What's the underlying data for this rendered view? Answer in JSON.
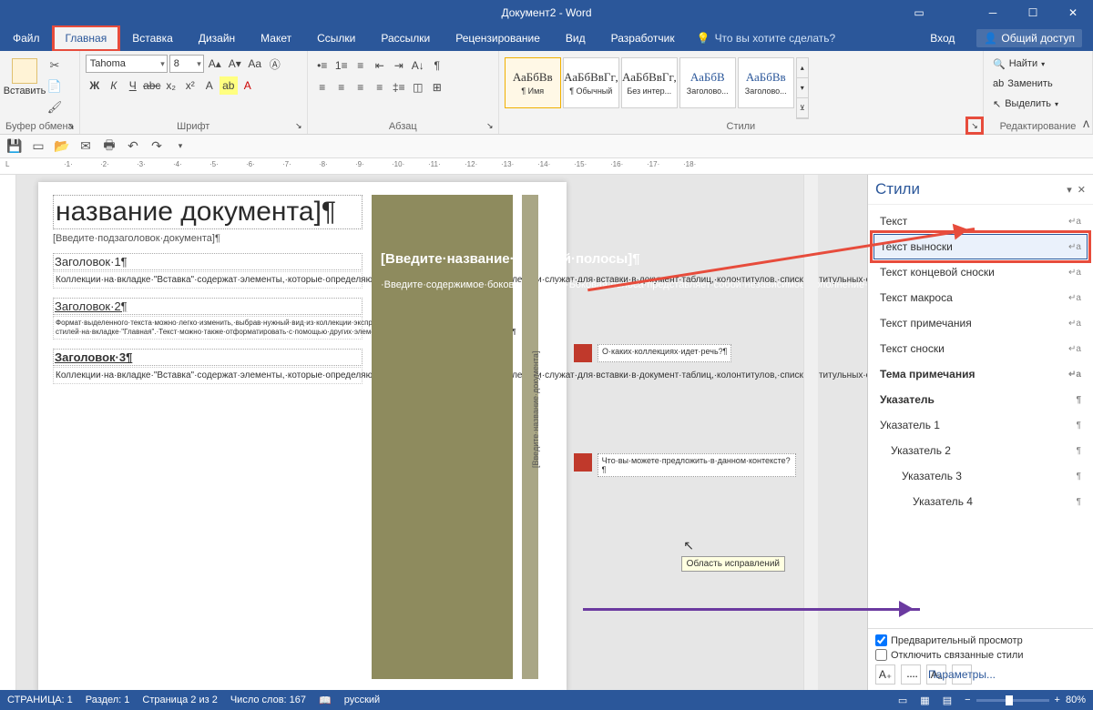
{
  "title": "Документ2 - Word",
  "tabs": [
    "Файл",
    "Главная",
    "Вставка",
    "Дизайн",
    "Макет",
    "Ссылки",
    "Рассылки",
    "Рецензирование",
    "Вид",
    "Разработчик"
  ],
  "activeTab": 1,
  "tellme": "Что вы хотите сделать?",
  "login": "Вход",
  "share": "Общий доступ",
  "ribbon": {
    "clipboard": {
      "paste": "Вставить",
      "label": "Буфер обмена"
    },
    "font": {
      "name": "Tahoma",
      "size": "8",
      "label": "Шрифт"
    },
    "para": {
      "label": "Абзац"
    },
    "styles": {
      "label": "Стили",
      "items": [
        {
          "prev": "АаБбВв",
          "name": "¶ Имя"
        },
        {
          "prev": "АаБбВвГг,",
          "name": "¶ Обычный"
        },
        {
          "prev": "АаБбВвГг,",
          "name": "Без интер..."
        },
        {
          "prev": "АаБбВ",
          "name": "Заголово..."
        },
        {
          "prev": "АаБбВв",
          "name": "Заголово..."
        }
      ]
    },
    "edit": {
      "label": "Редактирование",
      "find": "Найти",
      "replace": "Заменить",
      "select": "Выделить"
    }
  },
  "document": {
    "title": "название документа]¶",
    "subtitle": "[Введите·подзаголовок·документа]¶",
    "h1": "Заголовок·1¶",
    "p1": "Коллекции·на·вкладке·\"Вставка\"·содержат·элементы,·которые·определяют·общий·вид·документа.·Эти·коллекции·служат·для·вставки·в·документ·таблиц,·колонтитулов,·списков,·титульных·страниц·и·других·стандартных·блоков.¶",
    "h2": "Заголовок·2¶",
    "p2": "Формат·выделенного·текста·можно·легко·изменить,·выбрав·нужный·вид·из·коллекции·экспресс-стилей·на·вкладке·\"Главная\".·Текст·можно·также·отформатировать·с·помощью·других·элементов·управления·на·вкладке·\"Главная\".·¶",
    "h3": "Заголовок·3¶",
    "p3": "Коллекции·на·вкладке·\"Вставка\"·содержат·элементы,·которые·определяют·общий·вид·документа.·Эти·коллекции·служат·для·вставки·в·документ·таблиц,·колонтитулов,·списков,·титульных·страниц·и·других·стандартных·блоков.¶",
    "sidebarTitle": "[Введите·название·боковой·полосы]¶",
    "sidebarBody": "·Введите·содержимое·боковой·полосы.·Боковая·полоса·представляет·собой·независимое·дополнение·к·основному·документу.·Обычно·она·выровнена·по·левому·или·правому·краю·страницы·либо·расположена·в·самом·верху·или·в·",
    "sidebarVert": "[Введите·название·документа]",
    "comment1": "О·каких·коллекциях·идет·речь?¶",
    "comment2": "Что·вы·можете·предложить·в·данном·контексте?¶",
    "tooltip": "Область исправлений"
  },
  "stylesPane": {
    "title": "Стили",
    "items": [
      {
        "name": "Текст",
        "mark": "↵a"
      },
      {
        "name": "Текст выноски",
        "mark": "↵a",
        "selected": true,
        "hl": true
      },
      {
        "name": "Текст концевой сноски",
        "mark": "↵a"
      },
      {
        "name": "Текст  макроса",
        "mark": "↵a"
      },
      {
        "name": "Текст примечания",
        "mark": "↵a"
      },
      {
        "name": "Текст сноски",
        "mark": "↵a"
      },
      {
        "name": "Тема примечания",
        "mark": "↵a",
        "bold": true
      },
      {
        "name": "Указатель",
        "mark": "¶",
        "bold": true
      },
      {
        "name": "Указатель 1",
        "mark": "¶"
      },
      {
        "name": "Указатель 2",
        "mark": "¶",
        "indent": 1
      },
      {
        "name": "Указатель 3",
        "mark": "¶",
        "indent": 2
      },
      {
        "name": "Указатель 4",
        "mark": "¶",
        "indent": 3
      }
    ],
    "preview": "Предварительный просмотр",
    "disable": "Отключить связанные стили",
    "options": "Параметры..."
  },
  "status": {
    "page": "СТРАНИЦА: 1",
    "section": "Раздел: 1",
    "pageof": "Страница 2 из 2",
    "words": "Число слов: 167",
    "lang": "русский",
    "zoom": "80%"
  }
}
